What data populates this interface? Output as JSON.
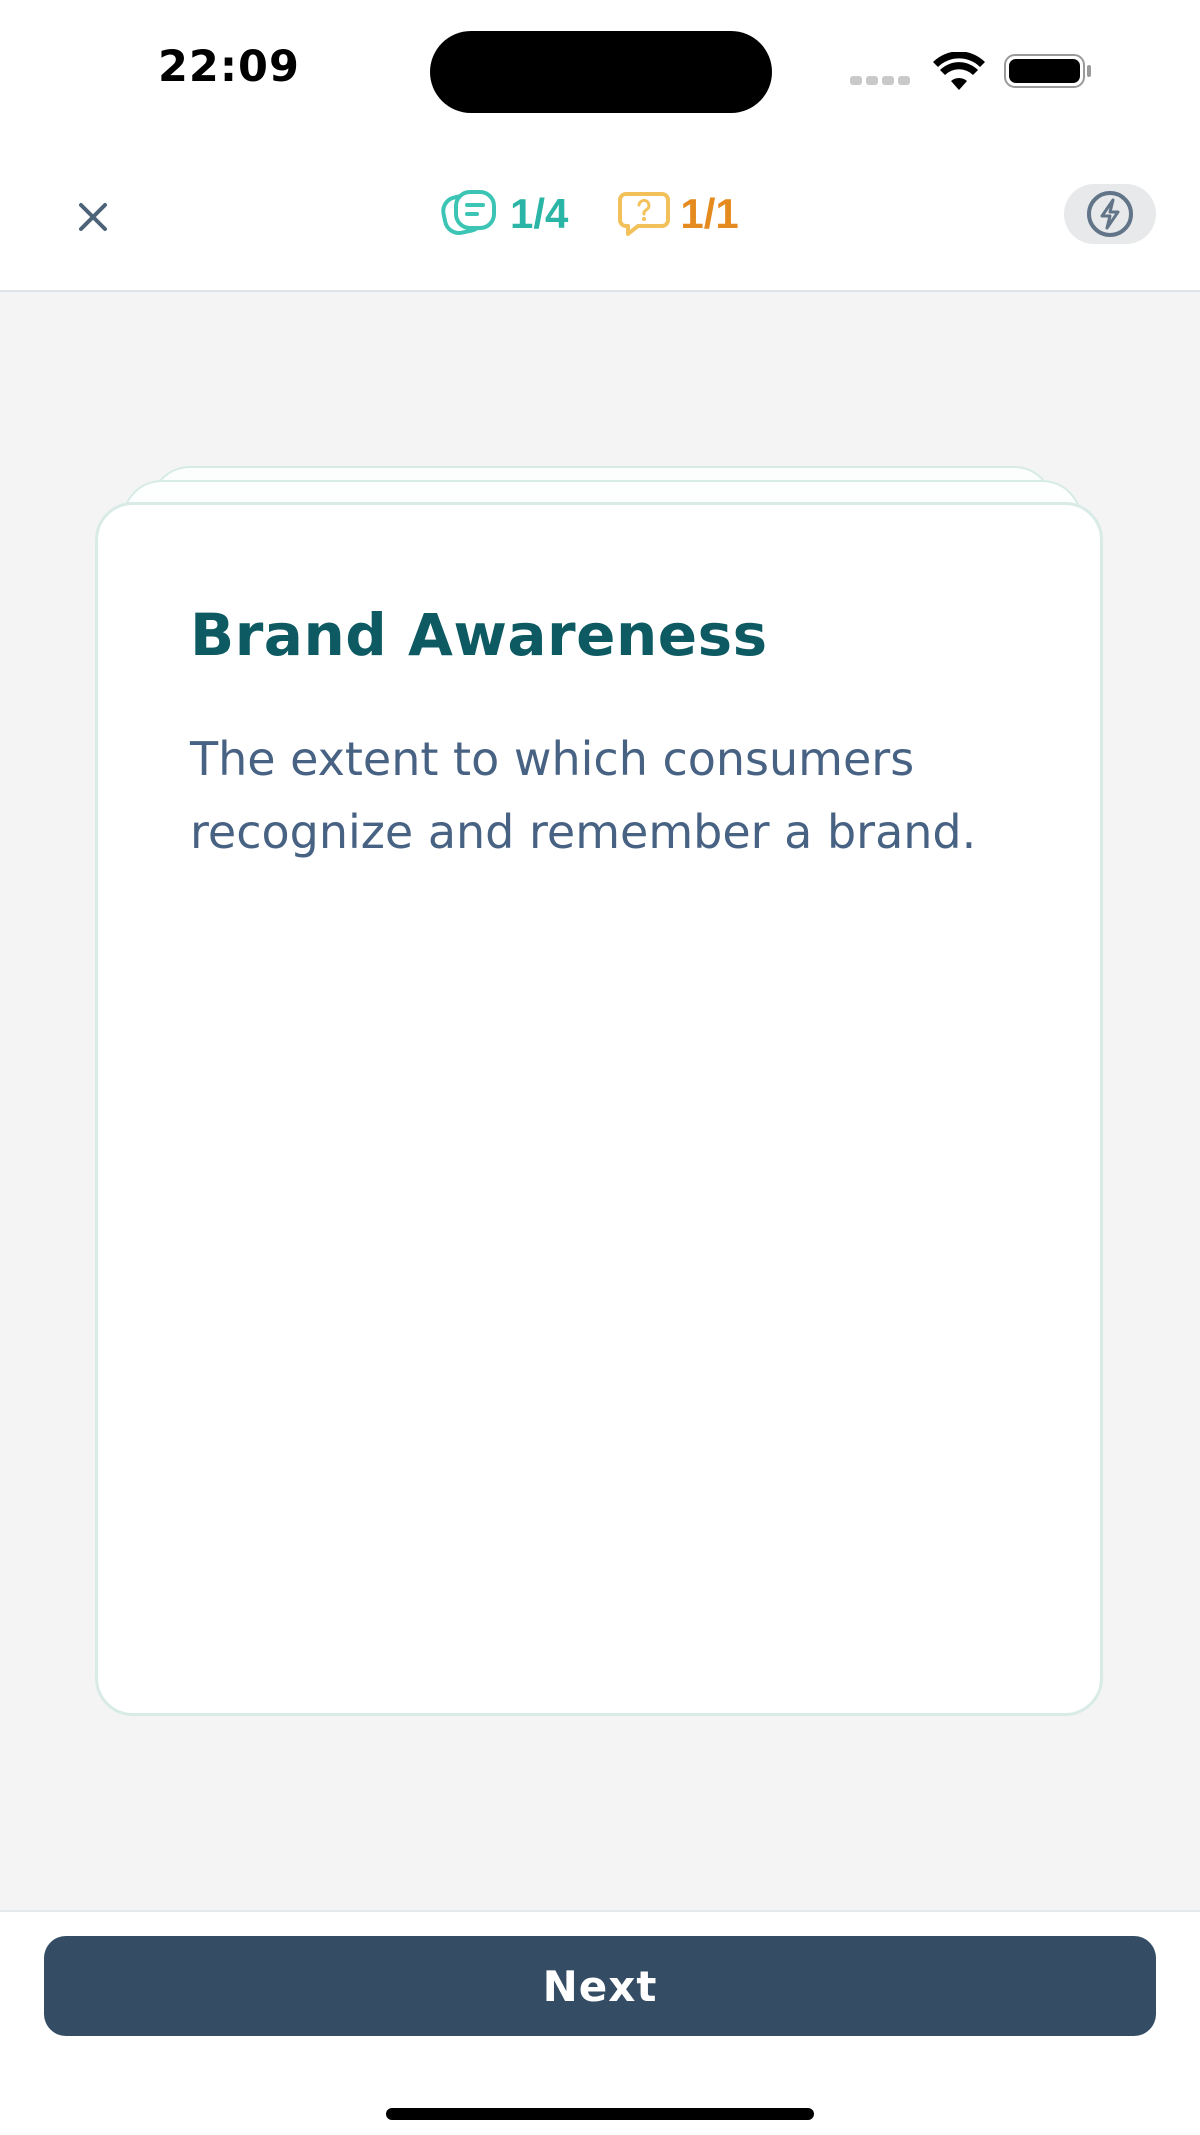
{
  "status_bar": {
    "time": "22:09"
  },
  "header": {
    "close_icon": "close-icon",
    "cards_counter": "1/4",
    "cards_icon": "flashcards-icon",
    "questions_counter": "1/1",
    "questions_icon": "question-bubble-icon",
    "flash_icon": "lightning-icon"
  },
  "card": {
    "title": "Brand Awareness",
    "definition": "The extent to which consumers recognize and remember a brand."
  },
  "footer": {
    "next_label": "Next"
  },
  "colors": {
    "accent_teal": "#2bb5a6",
    "accent_orange": "#e58a1f",
    "title": "#0d5a63",
    "body_text": "#476283",
    "button": "#344d64"
  }
}
